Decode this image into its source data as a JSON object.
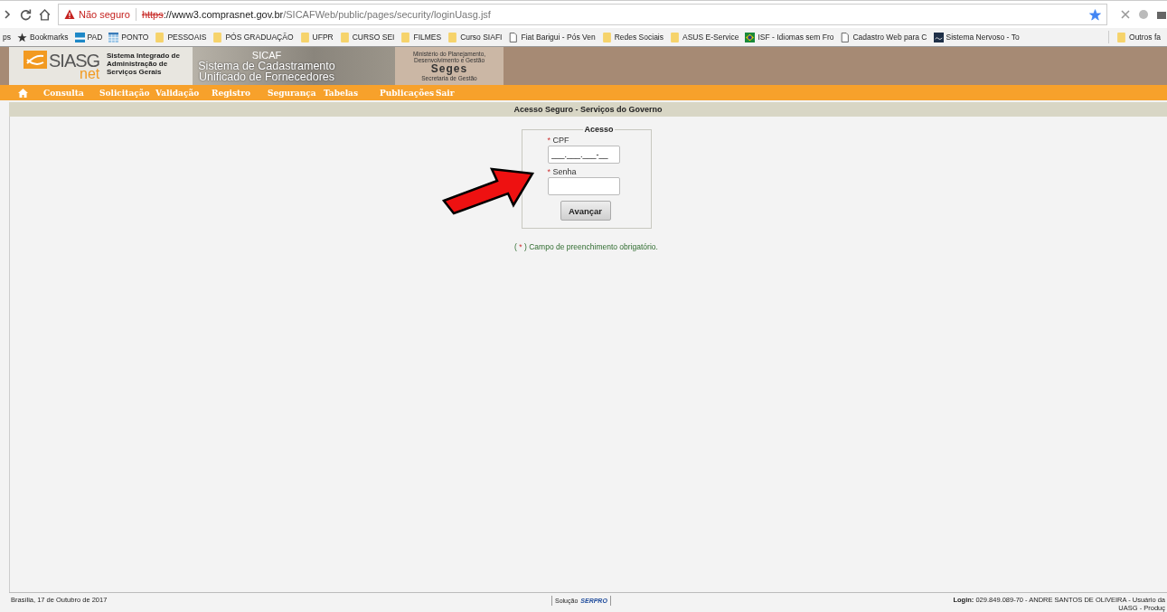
{
  "browser": {
    "security_label": "Não seguro",
    "url_scheme": "https",
    "url_host": "://www3.comprasnet.gov.br",
    "url_path": "/SICAFWeb/public/pages/security/loginUasg.jsf",
    "bookmarked": true
  },
  "bookmarks": [
    {
      "label": "ps",
      "kind": "apps"
    },
    {
      "label": "Bookmarks",
      "kind": "star"
    },
    {
      "label": "PAD",
      "kind": "sei"
    },
    {
      "label": "PONTO",
      "kind": "grid"
    },
    {
      "label": "PESSOAIS",
      "kind": "folder"
    },
    {
      "label": "PÓS GRADUAÇÃO",
      "kind": "folder"
    },
    {
      "label": "UFPR",
      "kind": "folder"
    },
    {
      "label": "CURSO SEI",
      "kind": "folder"
    },
    {
      "label": "FILMES",
      "kind": "folder"
    },
    {
      "label": "Curso SIAFI",
      "kind": "folder"
    },
    {
      "label": "Fiat Barigui - Pós Ven",
      "kind": "page"
    },
    {
      "label": "Redes Sociais",
      "kind": "folder"
    },
    {
      "label": "ASUS E-Service",
      "kind": "folder"
    },
    {
      "label": "ISF - Idiomas sem Fro",
      "kind": "flag"
    },
    {
      "label": "Cadastro Web para C",
      "kind": "page"
    },
    {
      "label": "Sistema Nervoso - To",
      "kind": "dark"
    }
  ],
  "other_bookmarks": "Outros fa",
  "banner": {
    "logo_text": "SIASG",
    "logo_sub": "net",
    "system_name": [
      "Sistema Integrado de",
      "Administração de",
      "Serviços Gerais"
    ],
    "app_acronym": "SICAF",
    "app_name": [
      "Sistema de Cadastramento",
      "Unificado de Fornecedores"
    ],
    "ministry": [
      "Ministério do Planejamento,",
      "Desenvolvimento e Gestão"
    ],
    "agency": "Seges",
    "agency_name": "Secretaria de Gestão"
  },
  "menu": [
    "Consulta",
    "Solicitação",
    "Validação",
    "Registro",
    "Segurança",
    "Tabelas",
    "Publicações",
    "Sair"
  ],
  "page_title": "Acesso Seguro - Serviços do Governo",
  "login": {
    "legend": "Acesso",
    "fields": [
      {
        "label": "CPF",
        "required": true,
        "value": "___.___.___-__"
      },
      {
        "label": "Senha",
        "required": true
      }
    ],
    "button": "Avançar"
  },
  "required_note": {
    "open": "(",
    "mark": "*",
    "close": ")",
    "text": "Campo de preenchimento obrigatório."
  },
  "footer": {
    "date": "Brasília, 17 de Outubro de 2017",
    "vendor_prefix": "Solução",
    "vendor": "SERPRO",
    "login_label": "Login:",
    "login_value": "029.849.089-70 - ANDRE SANTOS DE OLIVEIRA - Usuário da",
    "login_line2": "UASG - Produç"
  }
}
